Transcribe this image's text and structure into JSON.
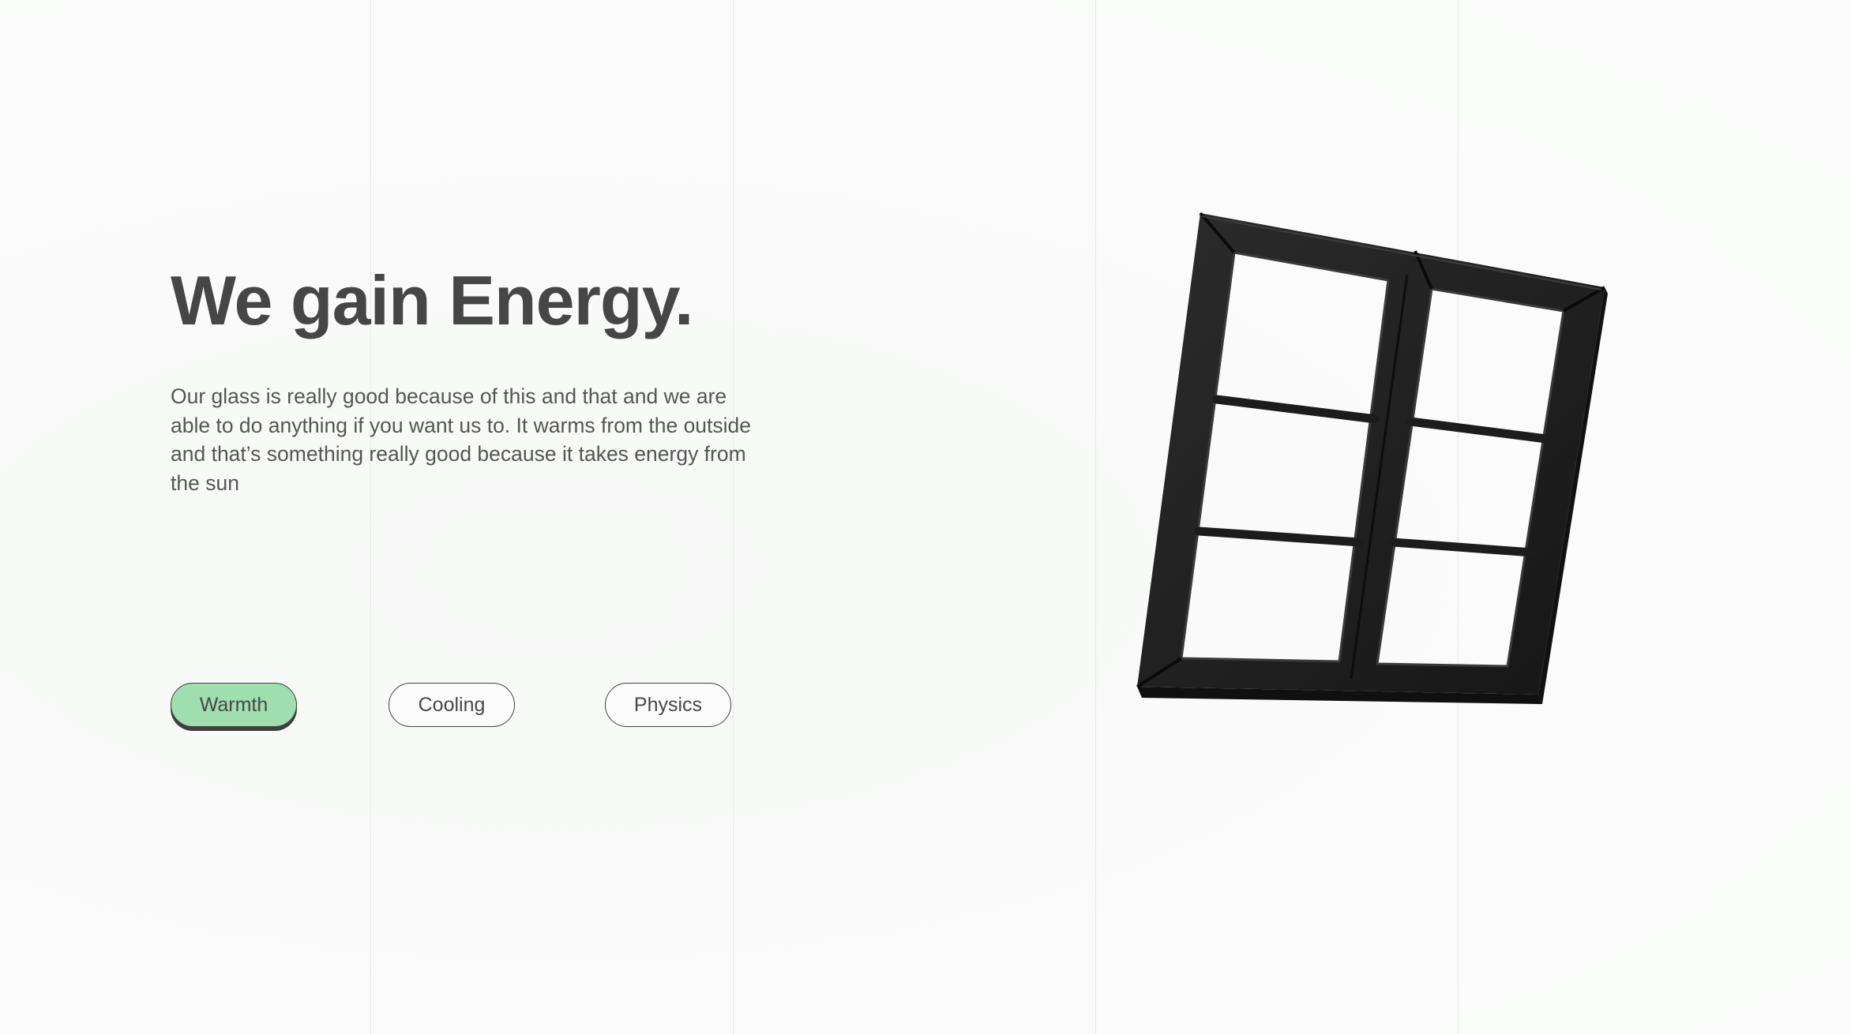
{
  "hero": {
    "title": "We gain Energy.",
    "body": "Our glass is really good because of this and that and we are able to do anything if you want us to. It warms from the outside and that’s something really good because it takes energy from the sun"
  },
  "tabs": [
    {
      "label": "Warmth",
      "active": true
    },
    {
      "label": "Cooling",
      "active": false
    },
    {
      "label": "Physics",
      "active": false
    }
  ],
  "colors": {
    "background": "#fafbfa",
    "text": "#464646",
    "accent": "#9fdeae",
    "frame": "#232323"
  },
  "illustration": {
    "icon": "window-frame-icon"
  }
}
